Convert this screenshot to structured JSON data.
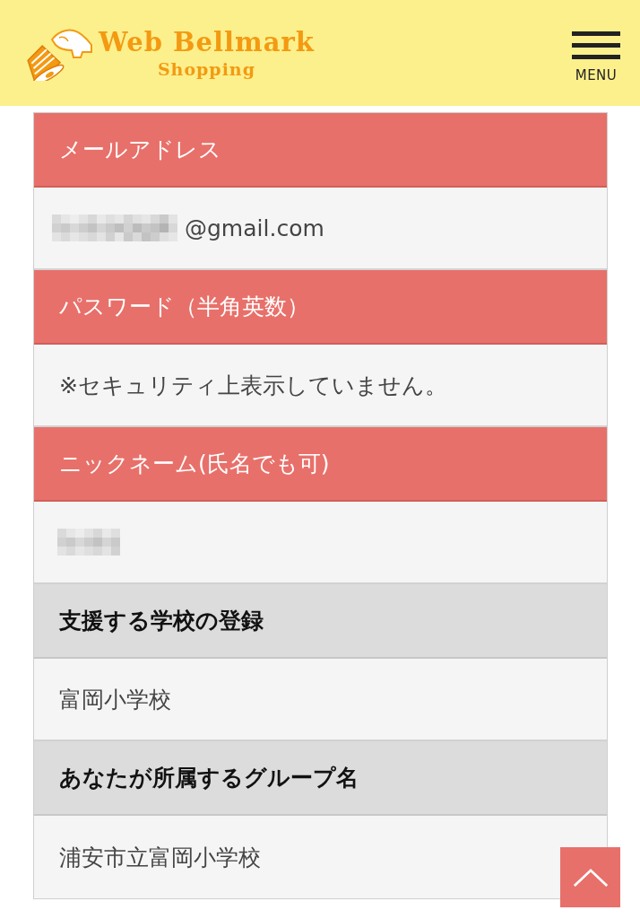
{
  "header": {
    "logo": {
      "title": "Web Bellmark",
      "subtitle": "Shopping"
    },
    "menu_button": {
      "label": "MENU"
    }
  },
  "sections": [
    {
      "kind": "accent",
      "label": "メールアドレス",
      "value": "@gmail.com",
      "redacted": true
    },
    {
      "kind": "accent",
      "label": "パスワード（半角英数）",
      "value": "※セキュリティ上表示していません。",
      "redacted": false
    },
    {
      "kind": "accent",
      "label": "ニックネーム(氏名でも可)",
      "redacted": true
    },
    {
      "kind": "muted",
      "label": "支援する学校の登録",
      "value": "富岡小学校",
      "redacted": false
    },
    {
      "kind": "muted",
      "label": "あなたが所属するグループ名",
      "value": "浦安市立富岡小学校",
      "redacted": false
    }
  ],
  "back_to_top": true
}
